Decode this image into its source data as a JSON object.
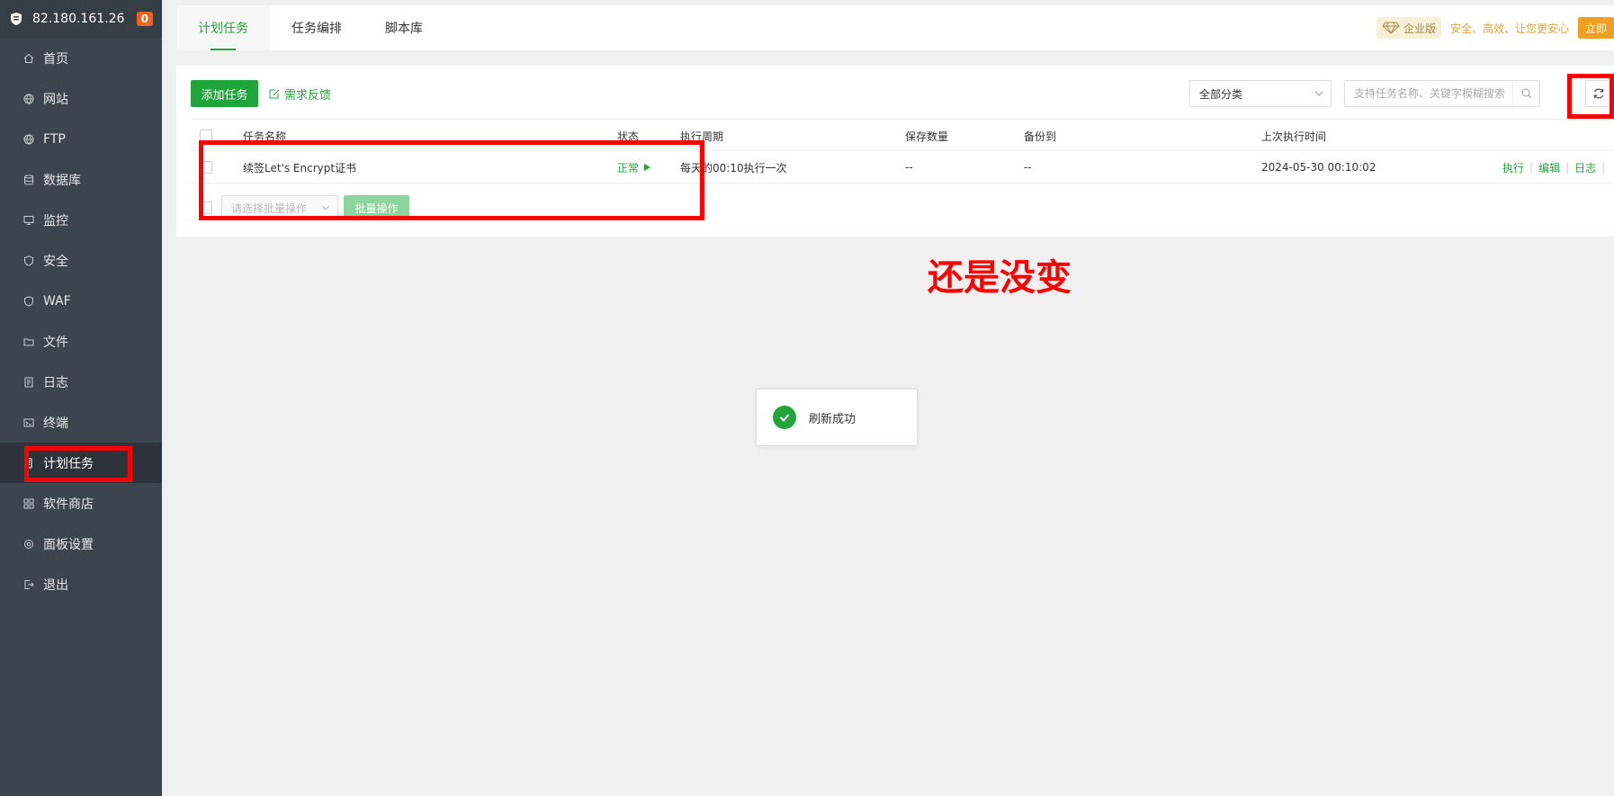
{
  "sidebar": {
    "ip": "82.180.161.26",
    "badge": "0",
    "items": [
      {
        "label": "首页",
        "icon": "home-icon"
      },
      {
        "label": "网站",
        "icon": "globe-icon"
      },
      {
        "label": "FTP",
        "icon": "globe-icon"
      },
      {
        "label": "数据库",
        "icon": "database-icon"
      },
      {
        "label": "监控",
        "icon": "monitor-icon"
      },
      {
        "label": "安全",
        "icon": "shield-icon"
      },
      {
        "label": "WAF",
        "icon": "shield-icon"
      },
      {
        "label": "文件",
        "icon": "folder-icon"
      },
      {
        "label": "日志",
        "icon": "log-icon"
      },
      {
        "label": "终端",
        "icon": "terminal-icon"
      },
      {
        "label": "计划任务",
        "icon": "schedule-icon"
      },
      {
        "label": "软件商店",
        "icon": "grid-icon"
      },
      {
        "label": "面板设置",
        "icon": "gear-icon"
      },
      {
        "label": "退出",
        "icon": "logout-icon"
      }
    ]
  },
  "tabs": [
    "计划任务",
    "任务编排",
    "脚本库"
  ],
  "enterprise": {
    "badge": "企业版",
    "slogan": "安全、高效、让您更安心",
    "button": "立即"
  },
  "toolbar": {
    "add_label": "添加任务",
    "feedback_label": "需求反馈",
    "category_value": "全部分类",
    "search_placeholder": "支持任务名称、关键字模糊搜索"
  },
  "table": {
    "headers": [
      "任务名称",
      "状态",
      "执行周期",
      "保存数量",
      "备份到",
      "上次执行时间"
    ],
    "rows": [
      {
        "name": "续签Let's Encrypt证书",
        "status": "正常",
        "cycle": "每天的00:10执行一次",
        "keep": "--",
        "backup": "--",
        "last_run": "2024-05-30 00:10:02",
        "ops": [
          "执行",
          "编辑",
          "日志"
        ]
      }
    ]
  },
  "batch": {
    "select_placeholder": "请选择批量操作",
    "button": "批量操作"
  },
  "annotation": "还是没变",
  "toast": "刷新成功",
  "colors": {
    "accent": "#20a53a",
    "sidebar": "#3c444d",
    "annotation": "#ff0000"
  }
}
